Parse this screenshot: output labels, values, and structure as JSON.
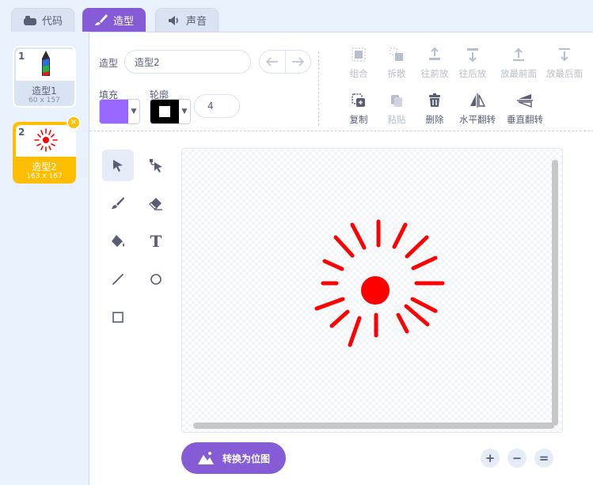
{
  "tabs": [
    {
      "label": "代码",
      "icon": "code-icon",
      "active": false
    },
    {
      "label": "造型",
      "icon": "brush-icon",
      "active": true
    },
    {
      "label": "声音",
      "icon": "speaker-icon",
      "active": false
    }
  ],
  "costumes": [
    {
      "number": "1",
      "name": "造型1",
      "size": "60 x 157",
      "selected": false
    },
    {
      "number": "2",
      "name": "造型2",
      "size": "163 x 167",
      "selected": true
    }
  ],
  "editor": {
    "costume_label": "造型",
    "costume_name": "造型2",
    "fill_label": "填充",
    "outline_label": "轮廓",
    "fill_color": "#9966ff",
    "outline_color": "#000000",
    "stroke_width": "4"
  },
  "toolbar": {
    "row1": [
      {
        "label": "组合",
        "icon": "group-icon",
        "enabled": false
      },
      {
        "label": "拆散",
        "icon": "ungroup-icon",
        "enabled": false
      },
      {
        "label": "往前放",
        "icon": "forward-icon",
        "enabled": false
      },
      {
        "label": "往后放",
        "icon": "backward-icon",
        "enabled": false
      },
      {
        "label": "放最前面",
        "icon": "front-icon",
        "enabled": false
      },
      {
        "label": "放最后面",
        "icon": "back-icon",
        "enabled": false
      }
    ],
    "row2": [
      {
        "label": "复制",
        "icon": "copy-icon",
        "enabled": true
      },
      {
        "label": "粘贴",
        "icon": "paste-icon",
        "enabled": false
      },
      {
        "label": "删除",
        "icon": "trash-icon",
        "enabled": true
      },
      {
        "label": "水平翻转",
        "icon": "flip-horizontal-icon",
        "enabled": true
      },
      {
        "label": "垂直翻转",
        "icon": "flip-vertical-icon",
        "enabled": true
      }
    ]
  },
  "tools": [
    "select-icon",
    "reshape-icon",
    "brush-icon",
    "eraser-icon",
    "fill-icon",
    "text-icon",
    "line-icon",
    "circle-icon",
    "rectangle-icon"
  ],
  "text_tool_glyph": "T",
  "convert_button": "转换为位图",
  "zoom": {
    "in": "+",
    "out": "−",
    "reset": "="
  },
  "accent_color": "#855cd6",
  "drawing_color": "#ff0000"
}
